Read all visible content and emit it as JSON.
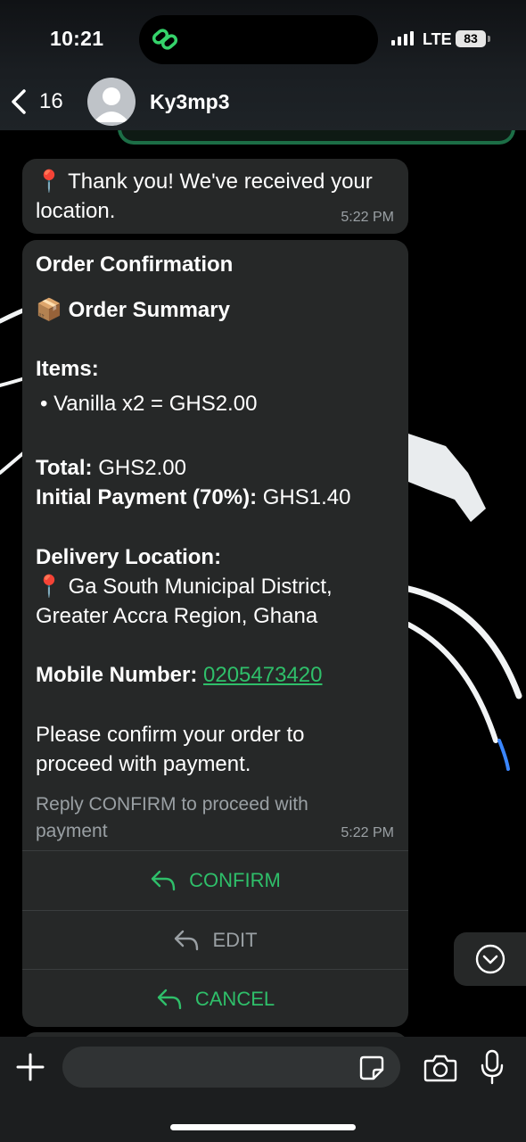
{
  "status_bar": {
    "time": "10:21",
    "network": "LTE",
    "battery": "83"
  },
  "header": {
    "back_count": "16",
    "contact_name": "Ky3mp3"
  },
  "messages": {
    "location": {
      "emoji": "📍",
      "text_line1": "Thank you! We've received your",
      "text_line2": "location.",
      "time": "5:22 PM"
    },
    "order": {
      "title": "Order Confirmation",
      "summary_emoji": "📦",
      "summary_label": "Order Summary",
      "items_label": "Items:",
      "item": "•  Vanilla x2 = GHS2.00",
      "total_label": "Total:",
      "total_value": "GHS2.00",
      "initial_label": "Initial Payment (70%):",
      "initial_value": "GHS1.40",
      "delivery_label": "Delivery Location:",
      "delivery_emoji": "📍",
      "delivery_line1": "Ga South Municipal District,",
      "delivery_line2": "Greater Accra Region, Ghana",
      "mobile_label": "Mobile Number:",
      "mobile_value": "0205473420",
      "confirm_line1": "Please confirm your order to",
      "confirm_line2": "proceed with payment.",
      "footer": "Reply CONFIRM to proceed with payment",
      "time": "5:22 PM",
      "quick_replies": [
        {
          "label": "CONFIRM"
        },
        {
          "label": "EDIT"
        },
        {
          "label": "CANCEL"
        }
      ]
    }
  },
  "composer": {
    "placeholder": ""
  },
  "icons": [
    "island-app-icon",
    "back-chevron-icon",
    "avatar-icon",
    "reply-arrow-icon",
    "chevron-down-icon",
    "plus-icon",
    "sticker-icon",
    "camera-icon",
    "mic-icon"
  ],
  "colors": {
    "accent_green": "#2fbf6a",
    "bubble": "#262828",
    "muted": "#9aa0a4"
  }
}
